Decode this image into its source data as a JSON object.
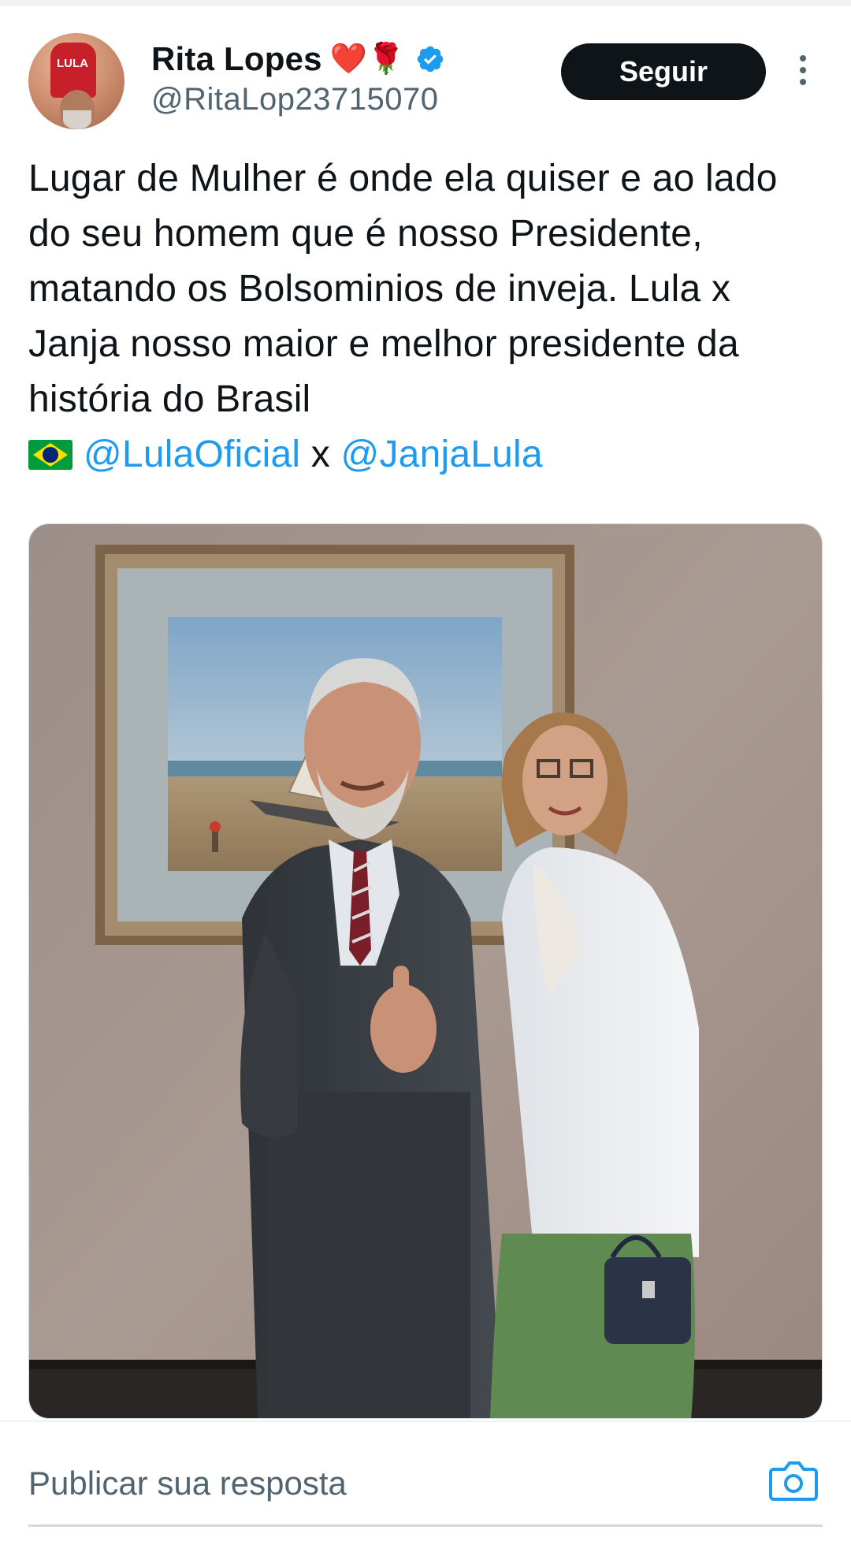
{
  "author": {
    "display_name": "Rita Lopes",
    "name_emojis": "❤️🌹",
    "handle": "@RitaLop23715070",
    "verified": true,
    "avatar_shirt_text": "LULA"
  },
  "actions": {
    "follow_label": "Seguir",
    "more_icon": "more-vertical-icon"
  },
  "tweet": {
    "text_main": "Lugar de Mulher é onde ela quiser e ao lado do seu homem que é nosso Presidente, matando os Bolsominios de inveja. Lula x Janja nosso maior e melhor presidente da história do Brasil",
    "flag_emoji": "🇧🇷",
    "mention_1": "@LulaOficial",
    "separator": "x",
    "mention_2": "@JanjaLula"
  },
  "reply": {
    "placeholder": "Publicar sua resposta",
    "camera_icon": "camera-icon"
  },
  "colors": {
    "accent": "#1d9bf0",
    "text": "#0f1419",
    "secondary_text": "#536471",
    "follow_bg": "#0f1419"
  }
}
